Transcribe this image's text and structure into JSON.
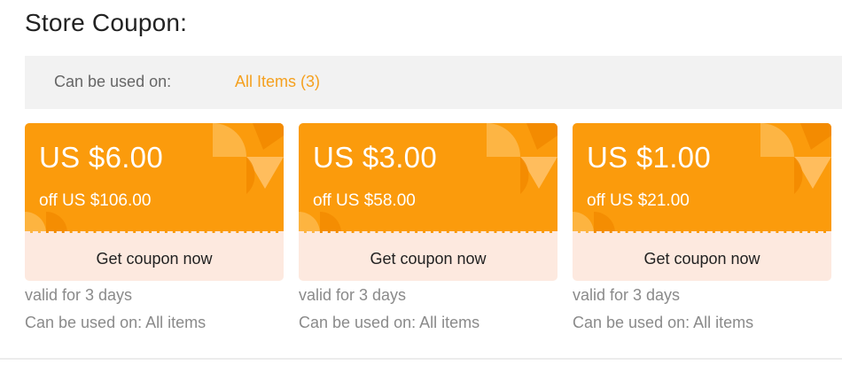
{
  "page": {
    "title": "Store Coupon:"
  },
  "filter": {
    "label": "Can be used on:",
    "value": "All Items (3)"
  },
  "colors": {
    "accent": "#f5a01e",
    "coupon_top": "#fb9b0c",
    "coupon_bottom": "#fde9df",
    "muted_text": "#8a8a8a"
  },
  "coupons": [
    {
      "amount": "US $6.00",
      "min_spend": "off US $106.00",
      "button_label": "Get coupon now",
      "validity": "valid for 3 days",
      "usage": "Can be used on: All items"
    },
    {
      "amount": "US $3.00",
      "min_spend": "off US $58.00",
      "button_label": "Get coupon now",
      "validity": "valid for 3 days",
      "usage": "Can be used on: All items"
    },
    {
      "amount": "US $1.00",
      "min_spend": "off US $21.00",
      "button_label": "Get coupon now",
      "validity": "valid for 3 days",
      "usage": "Can be used on: All items"
    }
  ]
}
